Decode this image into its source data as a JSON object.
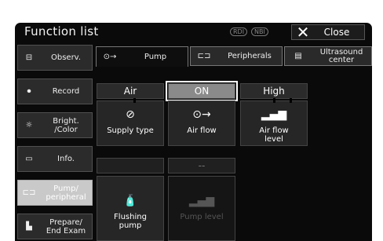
{
  "title": "Function list",
  "indicators": {
    "rdi": "RDI",
    "nbi": "NBI"
  },
  "close": {
    "icon": "close-x-icon",
    "label": "Close"
  },
  "sidebar": [
    {
      "icon": "observe-icon",
      "label": "Observ.",
      "active": false
    },
    {
      "icon": "record-icon",
      "label": "Record",
      "active": false
    },
    {
      "icon": "brightness-icon",
      "label": "Bright.\n/Color",
      "active": false
    },
    {
      "icon": "info-icon",
      "label": "Info.",
      "active": false
    },
    {
      "icon": "pump-peripheral-icon",
      "label": "Pump/\nperipheral",
      "active": true
    },
    {
      "icon": "exam-icon",
      "label": "Prepare/\nEnd Exam",
      "active": false
    }
  ],
  "tabs": [
    {
      "icon": "pump-icon",
      "label": "Pump",
      "active": true
    },
    {
      "icon": "peripherals-icon",
      "label": "Peripherals",
      "active": false
    },
    {
      "icon": "ultrasound-icon",
      "label": "Ultrasound\ncenter",
      "active": false
    }
  ],
  "headers": {
    "supply": "Air",
    "airflow": "ON",
    "level": "High",
    "pump_level": "--"
  },
  "cards": {
    "supply_type": "Supply type",
    "air_flow": "Air flow",
    "air_flow_level": "Air flow\nlevel",
    "flushing_pump": "Flushing\npump",
    "pump_level": "Pump level"
  },
  "colors": {
    "background": "#0a0a0a",
    "button": "#2b2b2b",
    "active": "#8a8a8a",
    "highlight": "#ffffff"
  }
}
